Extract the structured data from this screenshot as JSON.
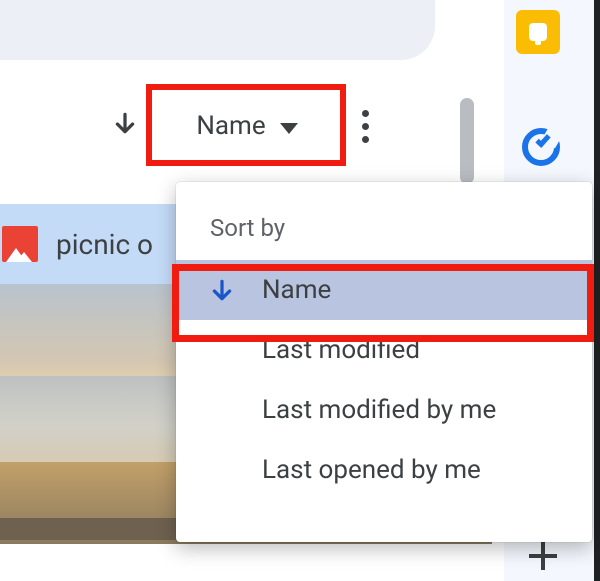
{
  "toolbar": {
    "sort_field": "Name"
  },
  "file": {
    "name": "picnic o"
  },
  "menu": {
    "title": "Sort by",
    "items": [
      {
        "label": "Name",
        "selected": true,
        "icon": "down-arrow-icon"
      },
      {
        "label": "Last modified",
        "selected": false
      },
      {
        "label": "Last modified by me",
        "selected": false
      },
      {
        "label": "Last opened by me",
        "selected": false
      }
    ]
  },
  "colors": {
    "highlight": "#ef1c0f",
    "accent": "#1a73e8"
  }
}
